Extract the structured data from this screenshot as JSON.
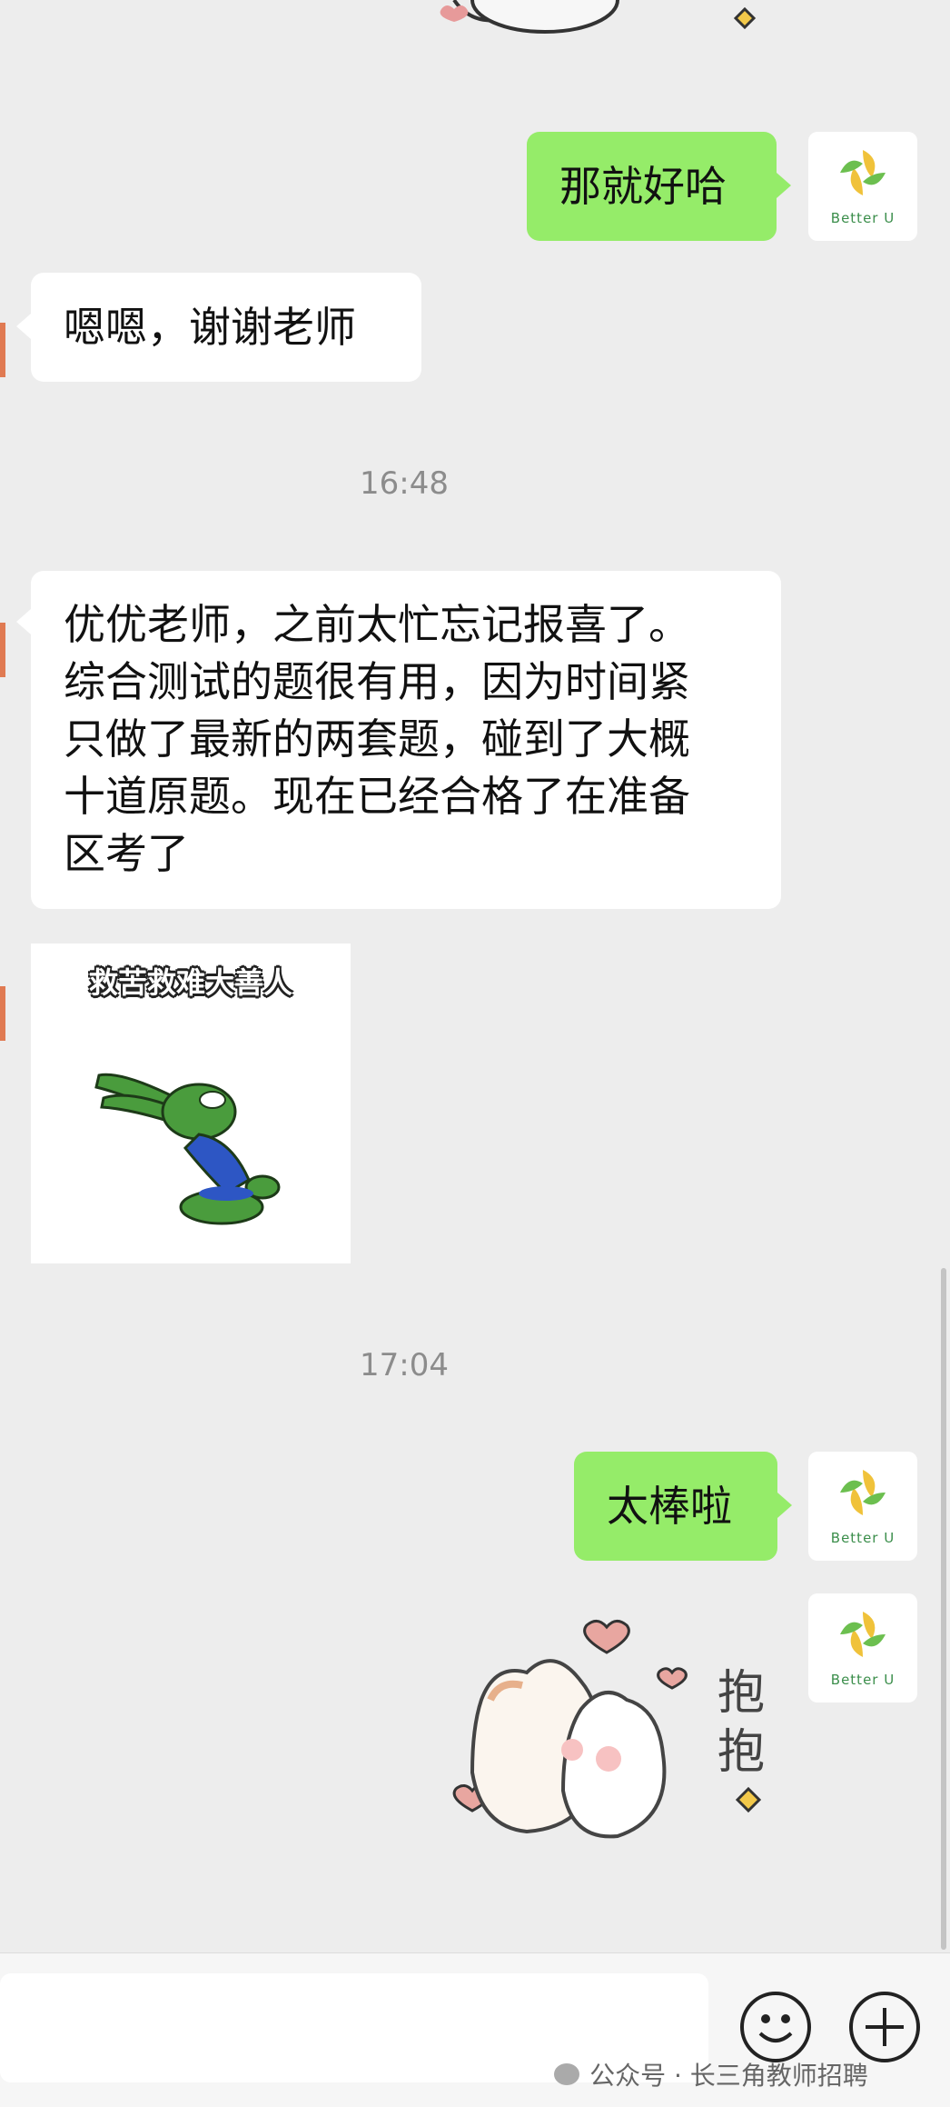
{
  "messages": {
    "m1": "那就好哈",
    "m2": "嗯嗯，谢谢老师",
    "m3_lines": [
      "优优老师，之前太忙忘记报喜了。",
      "综合测试的题很有用，因为时间紧",
      "只做了最新的两套题，碰到了大概",
      "十道原题。现在已经合格了在准备",
      "区考了"
    ],
    "m5": "太棒啦"
  },
  "timestamps": {
    "t1": "16:48",
    "t2": "17:04"
  },
  "stickers": {
    "frog_caption": "救苦救难大善人",
    "hug_text_1": "抱",
    "hug_text_2": "抱"
  },
  "avatar": {
    "brand": "Better U"
  },
  "watermark": "公众号 · 长三角教师招聘",
  "colors": {
    "background": "#ededed",
    "outgoing_bubble": "#95ec69",
    "incoming_bubble": "#ffffff",
    "timestamp": "#8c8c8c"
  }
}
